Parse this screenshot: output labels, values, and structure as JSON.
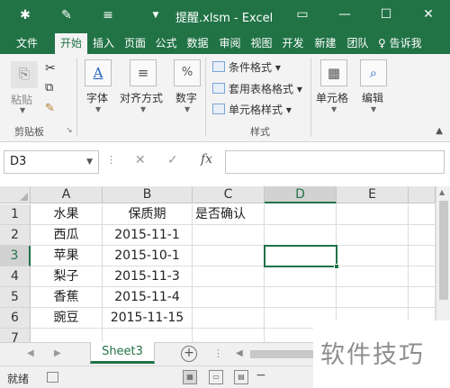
{
  "app": {
    "title": "提醒.xlsm - Excel",
    "accent": "#217346"
  },
  "quick_access": {
    "autosave_icon": "pin-icon",
    "brush_icon": "format-painter-icon",
    "customize_icon": "menu-icon"
  },
  "tabs": [
    {
      "label": "文件"
    },
    {
      "label": "开始"
    },
    {
      "label": "插入"
    },
    {
      "label": "页面"
    },
    {
      "label": "公式"
    },
    {
      "label": "数据"
    },
    {
      "label": "审阅"
    },
    {
      "label": "视图"
    },
    {
      "label": "开发"
    },
    {
      "label": "新建"
    },
    {
      "label": "团队"
    }
  ],
  "tell_me": "告诉我",
  "ribbon": {
    "paste": "粘贴",
    "clipboard_group": "剪贴板",
    "font": "字体",
    "alignment": "对齐方式",
    "number": "数字",
    "conditional_format": "条件格式",
    "table_format": "套用表格格式",
    "cell_styles": "单元格样式",
    "styles_group": "样式",
    "cells": "单元格",
    "editing": "编辑"
  },
  "formula_bar": {
    "name_box": "D3",
    "fx": "fx",
    "cancel": "✕",
    "confirm": "✓",
    "value": ""
  },
  "grid": {
    "columns": [
      "A",
      "B",
      "C",
      "D",
      "E"
    ],
    "rows": [
      "1",
      "2",
      "3",
      "4",
      "5",
      "6",
      "7"
    ],
    "cells": {
      "A1": "水果",
      "B1": "保质期",
      "C1": "是否确认",
      "A2": "西瓜",
      "B2": "2015-11-1",
      "A3": "苹果",
      "B3": "2015-10-1",
      "A4": "梨子",
      "B4": "2015-11-3",
      "A5": "香蕉",
      "B5": "2015-11-4",
      "A6": "豌豆",
      "B6": "2015-11-15"
    },
    "selected_cell": "D3"
  },
  "sheet_tabs": [
    "Sheet3"
  ],
  "status": {
    "ready": "就绪"
  },
  "watermark": "软件技巧"
}
